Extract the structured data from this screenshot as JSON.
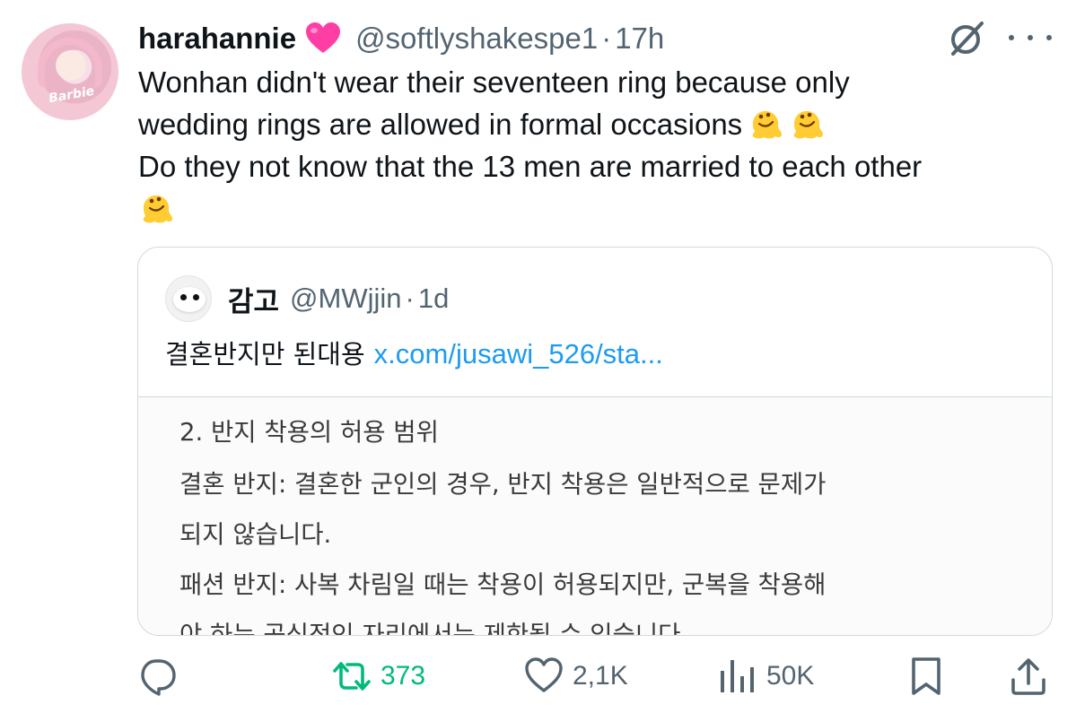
{
  "tweet": {
    "display_name": "harahannie",
    "name_emoji": "pink-heart-icon",
    "handle": "@softlyshakespe1",
    "separator": "·",
    "time": "17h",
    "avatar_text": "Barbie",
    "lines": [
      "Wonhan didn't wear their seventeen ring because only",
      "wedding rings are allowed in formal occasions",
      "Do they not know that the 13 men are married to each other"
    ],
    "emoji": "melting-face-icon"
  },
  "quoted": {
    "display_name": "감고",
    "handle": "@MWjjin",
    "separator": "·",
    "time": "1d",
    "text": "결혼반지만 된대용",
    "link": "x.com/jusawi_526/sta...",
    "image_lines": [
      "2. 반지 착용의 허용 범위",
      "결혼 반지: 결혼한 군인의 경우, 반지 착용은 일반적으로 문제가",
      "되지 않습니다.",
      "패션 반지: 사복 차림일 때는 착용이 허용되지만, 군복을 착용해",
      "야 하는 공식적인 자리에서는 제한될 수 있습니다."
    ]
  },
  "actions": {
    "reply": {
      "icon": "reply-icon",
      "count": ""
    },
    "retweet": {
      "icon": "retweet-icon",
      "count": "373"
    },
    "like": {
      "icon": "heart-icon",
      "count": "2,1K"
    },
    "views": {
      "icon": "views-icon",
      "count": "50K"
    },
    "bookmark": {
      "icon": "bookmark-icon"
    },
    "share": {
      "icon": "share-icon"
    }
  },
  "colors": {
    "text": "#0f1419",
    "secondary": "#536471",
    "link": "#1d9bf0",
    "retweet_active": "#00ba7c",
    "border": "#cfd9de",
    "heart_emoji": "#ff3ea5"
  }
}
